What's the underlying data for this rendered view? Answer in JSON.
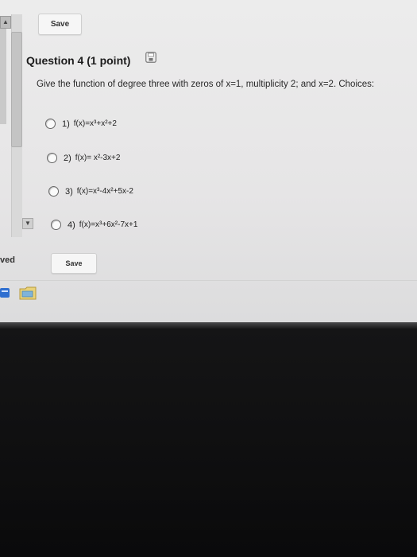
{
  "toolbar": {
    "save_label": "Save"
  },
  "footer": {
    "save_label": "Save",
    "saved_fragment": "ved"
  },
  "question": {
    "title": "Question 4 (1 point)",
    "text": "Give the function of degree three with zeros of x=1, multiplicity 2; and x=2. Choices:",
    "choices": [
      {
        "num": "1)",
        "text": "f(x)=x³+x²+2"
      },
      {
        "num": "2)",
        "text": "f(x)= x²-3x+2"
      },
      {
        "num": "3)",
        "text": "f(x)=x³-4x²+5x-2"
      },
      {
        "num": "4)",
        "text": "f(x)=x³+6x²-7x+1"
      }
    ]
  },
  "icons": {
    "save_status": "floppy-disk-icon",
    "scroll_up": "arrow-up-icon",
    "scroll_down": "arrow-down-icon"
  },
  "colors": {
    "screen_bg": "#e8e8e8",
    "bezel": "#0c0c0d",
    "button_bg": "#f6f6f6",
    "text": "#222222"
  }
}
